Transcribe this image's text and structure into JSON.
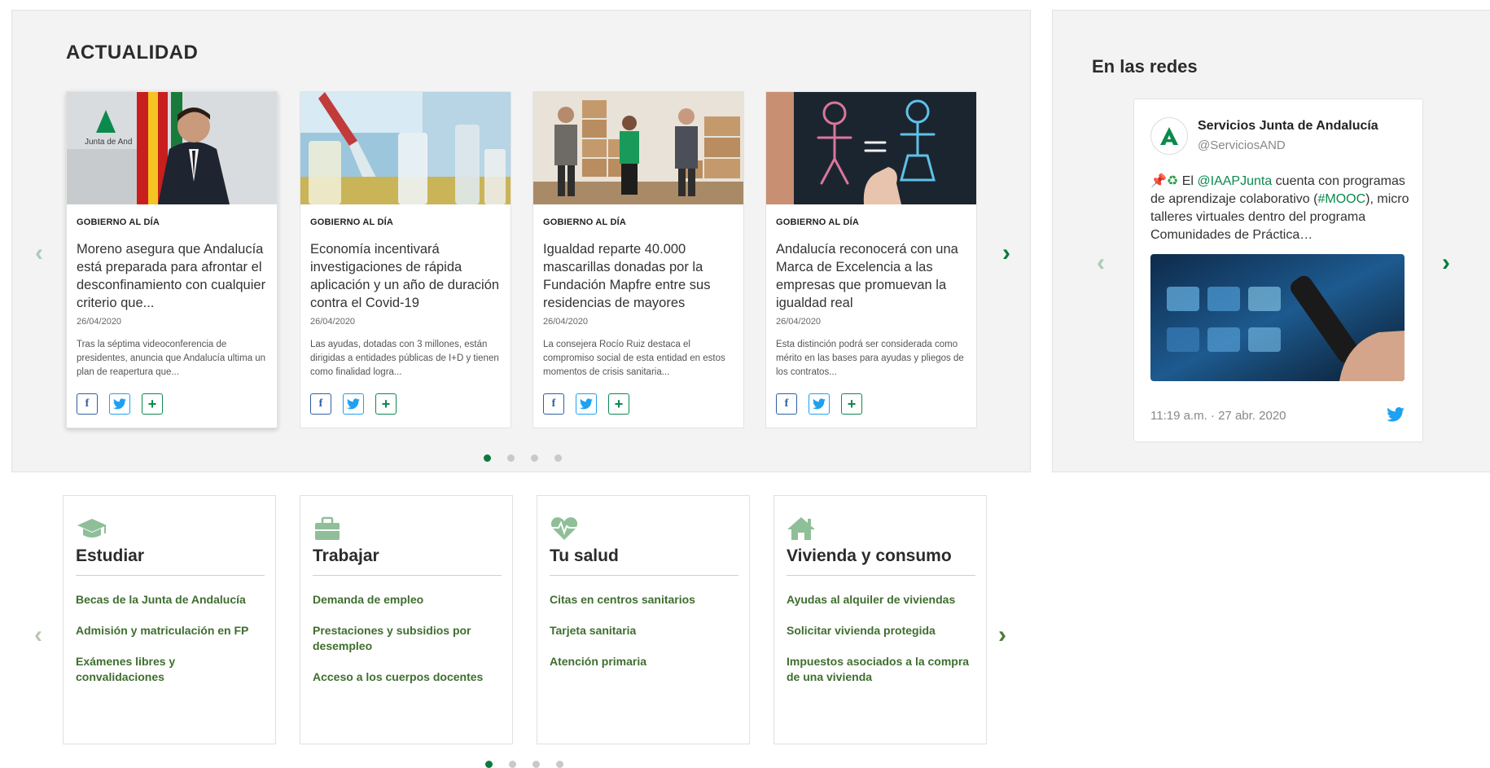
{
  "news": {
    "title": "ACTUALIDAD",
    "cards": [
      {
        "category": "GOBIERNO AL DÍA",
        "headline": "Moreno asegura que Andalucía está preparada para afrontar el desconfinamiento con cualquier criterio que...",
        "date": "26/04/2020",
        "summary": "Tras la séptima videoconferencia de presidentes, anuncia que Andalucía ultima un plan de reapertura que...",
        "image_text": "Junta de And"
      },
      {
        "category": "GOBIERNO AL DÍA",
        "headline": "Economía incentivará investigaciones de rápida aplicación y un año de duración contra el Covid-19",
        "date": "26/04/2020",
        "summary": "Las ayudas, dotadas con 3 millones, están dirigidas a entidades públicas de I+D y tienen como finalidad logra..."
      },
      {
        "category": "GOBIERNO AL DÍA",
        "headline": "Igualdad reparte 40.000 mascarillas donadas por la Fundación Mapfre entre sus residencias de mayores",
        "date": "26/04/2020",
        "summary": "La consejera Rocío Ruiz destaca el compromiso social de esta entidad en estos momentos de crisis sanitaria..."
      },
      {
        "category": "GOBIERNO AL DÍA",
        "headline": "Andalucía reconocerá con una Marca de Excelencia a las empresas que promuevan la igualdad real",
        "date": "26/04/2020",
        "summary": "Esta distinción podrá ser considerada como mérito en las bases para ayudas y pliegos de los contratos..."
      }
    ],
    "share": {
      "facebook": "f",
      "twitter": "twitter-icon",
      "more": "+"
    },
    "pagination": {
      "pages": 4,
      "current": 1
    },
    "prev_arrow": "‹",
    "next_arrow": "›"
  },
  "social": {
    "title": "En las redes",
    "tweet": {
      "name": "Servicios Junta de Andalucía",
      "handle": "@ServiciosAND",
      "text_pre": " El ",
      "mention": "@IAAPJunta",
      "text_mid": " cuenta con programas de aprendizaje colaborativo (",
      "hashtag": "#MOOC",
      "text_post": "), micro talleres virtuales dentro del programa Comunidades de Práctica…",
      "emoji_pin": "📌",
      "emoji_recycle": "♻",
      "time": "11:19 a.m. · 27 abr. 2020"
    },
    "prev_arrow": "‹",
    "next_arrow": "›"
  },
  "services": {
    "cards": [
      {
        "title": "Estudiar",
        "icon": "graduation-cap-icon",
        "links": [
          "Becas de la Junta de Andalucía",
          "Admisión y matriculación en FP",
          "Exámenes libres y convalidaciones"
        ]
      },
      {
        "title": "Trabajar",
        "icon": "briefcase-icon",
        "links": [
          "Demanda de empleo",
          "Prestaciones y subsidios por desempleo",
          "Acceso a los cuerpos docentes"
        ]
      },
      {
        "title": "Tu salud",
        "icon": "heart-pulse-icon",
        "links": [
          "Citas en centros sanitarios",
          "Tarjeta sanitaria",
          "Atención primaria"
        ]
      },
      {
        "title": "Vivienda y consumo",
        "icon": "house-icon",
        "links": [
          "Ayudas al alquiler de viviendas",
          "Solicitar vivienda protegida",
          "Impuestos asociados a la compra de una vivienda"
        ]
      }
    ],
    "pagination": {
      "pages": 4,
      "current": 1
    },
    "prev_arrow": "‹",
    "next_arrow": "›"
  },
  "colors": {
    "accent_green": "#0b7a3e",
    "link_green": "#3f6e2f",
    "icon_green": "#8fbf98",
    "panel_bg": "#f3f3f3",
    "twitter_blue": "#1da1f2",
    "facebook_blue": "#2d5fa3"
  }
}
